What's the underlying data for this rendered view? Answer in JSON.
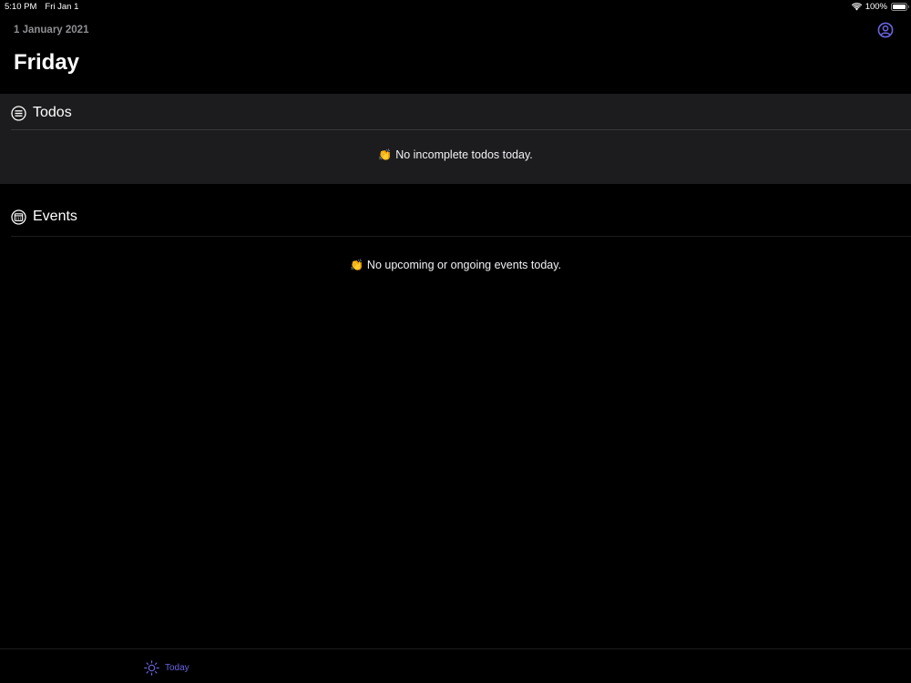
{
  "status_bar": {
    "time": "5:10 PM",
    "date": "Fri Jan 1",
    "battery": "100%",
    "icons": [
      "wifi-icon",
      "battery-icon"
    ]
  },
  "header": {
    "date_caption": "1 January 2021",
    "title": "Friday",
    "profile_icon": "person-circle-icon"
  },
  "todos": {
    "title": "Todos",
    "icon": "list-circle-icon",
    "empty_emoji": "👏",
    "empty_text": "No incomplete todos today."
  },
  "events": {
    "title": "Events",
    "icon": "calendar-circle-icon",
    "empty_emoji": "👏",
    "empty_text": "No upcoming or ongoing events today."
  },
  "tab_bar": {
    "tabs": [
      {
        "label": "Today",
        "icon": "sun-icon",
        "selected": true
      }
    ]
  },
  "colors": {
    "background": "#000000",
    "section_background": "#1c1c1e",
    "separator": "#38383a",
    "secondary_text": "#8e8e93",
    "accent": "#6a64e0"
  }
}
